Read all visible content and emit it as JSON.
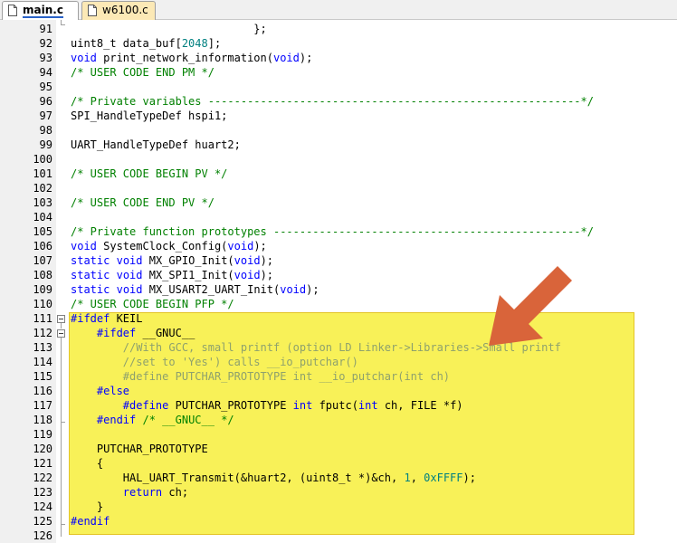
{
  "tabs": [
    {
      "label": "main.c",
      "active": true
    },
    {
      "label": "w6100.c",
      "active": false
    }
  ],
  "colors": {
    "keyword": "#0000ff",
    "comment": "#008000",
    "number": "#008080",
    "inactive": "#8ea16d",
    "highlight": "#f8f158",
    "arrow": "#d9643a"
  },
  "lines": [
    {
      "num": "91",
      "segments": [
        {
          "text": "                            };",
          "c": "n"
        }
      ]
    },
    {
      "num": "92",
      "segments": [
        {
          "text": "uint8_t data_buf[",
          "c": "n"
        },
        {
          "text": "2048",
          "c": "num"
        },
        {
          "text": "];",
          "c": "n"
        }
      ]
    },
    {
      "num": "93",
      "segments": [
        {
          "text": "void",
          "c": "kw"
        },
        {
          "text": " print_network_information(",
          "c": "n"
        },
        {
          "text": "void",
          "c": "kw"
        },
        {
          "text": ");",
          "c": "n"
        }
      ]
    },
    {
      "num": "94",
      "segments": [
        {
          "text": "/* USER CODE END PM */",
          "c": "cm"
        }
      ]
    },
    {
      "num": "95",
      "segments": []
    },
    {
      "num": "96",
      "segments": [
        {
          "text": "/* Private variables ---------------------------------------------------------*/",
          "c": "cm"
        }
      ]
    },
    {
      "num": "97",
      "segments": [
        {
          "text": "SPI_HandleTypeDef hspi1;",
          "c": "n"
        }
      ]
    },
    {
      "num": "98",
      "segments": []
    },
    {
      "num": "99",
      "segments": [
        {
          "text": "UART_HandleTypeDef huart2;",
          "c": "n"
        }
      ]
    },
    {
      "num": "100",
      "segments": []
    },
    {
      "num": "101",
      "segments": [
        {
          "text": "/* USER CODE BEGIN PV */",
          "c": "cm"
        }
      ]
    },
    {
      "num": "102",
      "segments": []
    },
    {
      "num": "103",
      "segments": [
        {
          "text": "/* USER CODE END PV */",
          "c": "cm"
        }
      ]
    },
    {
      "num": "104",
      "segments": []
    },
    {
      "num": "105",
      "segments": [
        {
          "text": "/* Private function prototypes -----------------------------------------------*/",
          "c": "cm"
        }
      ]
    },
    {
      "num": "106",
      "segments": [
        {
          "text": "void",
          "c": "kw"
        },
        {
          "text": " SystemClock_Config(",
          "c": "n"
        },
        {
          "text": "void",
          "c": "kw"
        },
        {
          "text": ");",
          "c": "n"
        }
      ]
    },
    {
      "num": "107",
      "segments": [
        {
          "text": "static",
          "c": "kw"
        },
        {
          "text": " ",
          "c": "n"
        },
        {
          "text": "void",
          "c": "kw"
        },
        {
          "text": " MX_GPIO_Init(",
          "c": "n"
        },
        {
          "text": "void",
          "c": "kw"
        },
        {
          "text": ");",
          "c": "n"
        }
      ]
    },
    {
      "num": "108",
      "segments": [
        {
          "text": "static",
          "c": "kw"
        },
        {
          "text": " ",
          "c": "n"
        },
        {
          "text": "void",
          "c": "kw"
        },
        {
          "text": " MX_SPI1_Init(",
          "c": "n"
        },
        {
          "text": "void",
          "c": "kw"
        },
        {
          "text": ");",
          "c": "n"
        }
      ]
    },
    {
      "num": "109",
      "segments": [
        {
          "text": "static",
          "c": "kw"
        },
        {
          "text": " ",
          "c": "n"
        },
        {
          "text": "void",
          "c": "kw"
        },
        {
          "text": " MX_USART2_UART_Init(",
          "c": "n"
        },
        {
          "text": "void",
          "c": "kw"
        },
        {
          "text": ");",
          "c": "n"
        }
      ]
    },
    {
      "num": "110",
      "segments": [
        {
          "text": "/* USER CODE BEGIN PFP */",
          "c": "cm"
        }
      ]
    },
    {
      "num": "111",
      "segments": [
        {
          "text": "#ifdef",
          "c": "kw"
        },
        {
          "text": " KEIL",
          "c": "n"
        }
      ]
    },
    {
      "num": "112",
      "segments": [
        {
          "text": "    ",
          "c": "n"
        },
        {
          "text": "#ifdef",
          "c": "kw"
        },
        {
          "text": " __GNUC__",
          "c": "n"
        }
      ]
    },
    {
      "num": "113",
      "segments": [
        {
          "text": "        //With GCC, small printf (option LD Linker->Libraries->Small printf",
          "c": "ia"
        }
      ]
    },
    {
      "num": "114",
      "segments": [
        {
          "text": "        //set to 'Yes') calls __io_putchar()",
          "c": "ia"
        }
      ]
    },
    {
      "num": "115",
      "segments": [
        {
          "text": "        #define PUTCHAR_PROTOTYPE int __io_putchar(int ch)",
          "c": "ia"
        }
      ]
    },
    {
      "num": "116",
      "segments": [
        {
          "text": "    ",
          "c": "n"
        },
        {
          "text": "#else",
          "c": "kw"
        }
      ]
    },
    {
      "num": "117",
      "segments": [
        {
          "text": "        ",
          "c": "n"
        },
        {
          "text": "#define",
          "c": "kw"
        },
        {
          "text": " PUTCHAR_PROTOTYPE ",
          "c": "n"
        },
        {
          "text": "int",
          "c": "kw"
        },
        {
          "text": " fputc(",
          "c": "n"
        },
        {
          "text": "int",
          "c": "kw"
        },
        {
          "text": " ch, FILE *f)",
          "c": "n"
        }
      ]
    },
    {
      "num": "118",
      "segments": [
        {
          "text": "    ",
          "c": "n"
        },
        {
          "text": "#endif",
          "c": "kw"
        },
        {
          "text": " ",
          "c": "n"
        },
        {
          "text": "/* __GNUC__ */",
          "c": "cm"
        }
      ]
    },
    {
      "num": "119",
      "segments": []
    },
    {
      "num": "120",
      "segments": [
        {
          "text": "    PUTCHAR_PROTOTYPE",
          "c": "n"
        }
      ]
    },
    {
      "num": "121",
      "segments": [
        {
          "text": "    {",
          "c": "n"
        }
      ]
    },
    {
      "num": "122",
      "segments": [
        {
          "text": "        HAL_UART_Transmit(&huart2, (uint8_t *)&ch, ",
          "c": "n"
        },
        {
          "text": "1",
          "c": "num"
        },
        {
          "text": ", ",
          "c": "n"
        },
        {
          "text": "0xFFFF",
          "c": "num"
        },
        {
          "text": ");",
          "c": "n"
        }
      ]
    },
    {
      "num": "123",
      "segments": [
        {
          "text": "        ",
          "c": "n"
        },
        {
          "text": "return",
          "c": "kw"
        },
        {
          "text": " ch;",
          "c": "n"
        }
      ]
    },
    {
      "num": "124",
      "segments": [
        {
          "text": "    }",
          "c": "n"
        }
      ]
    },
    {
      "num": "125",
      "segments": [
        {
          "text": "#endif",
          "c": "kw"
        }
      ]
    },
    {
      "num": "126",
      "segments": []
    }
  ]
}
